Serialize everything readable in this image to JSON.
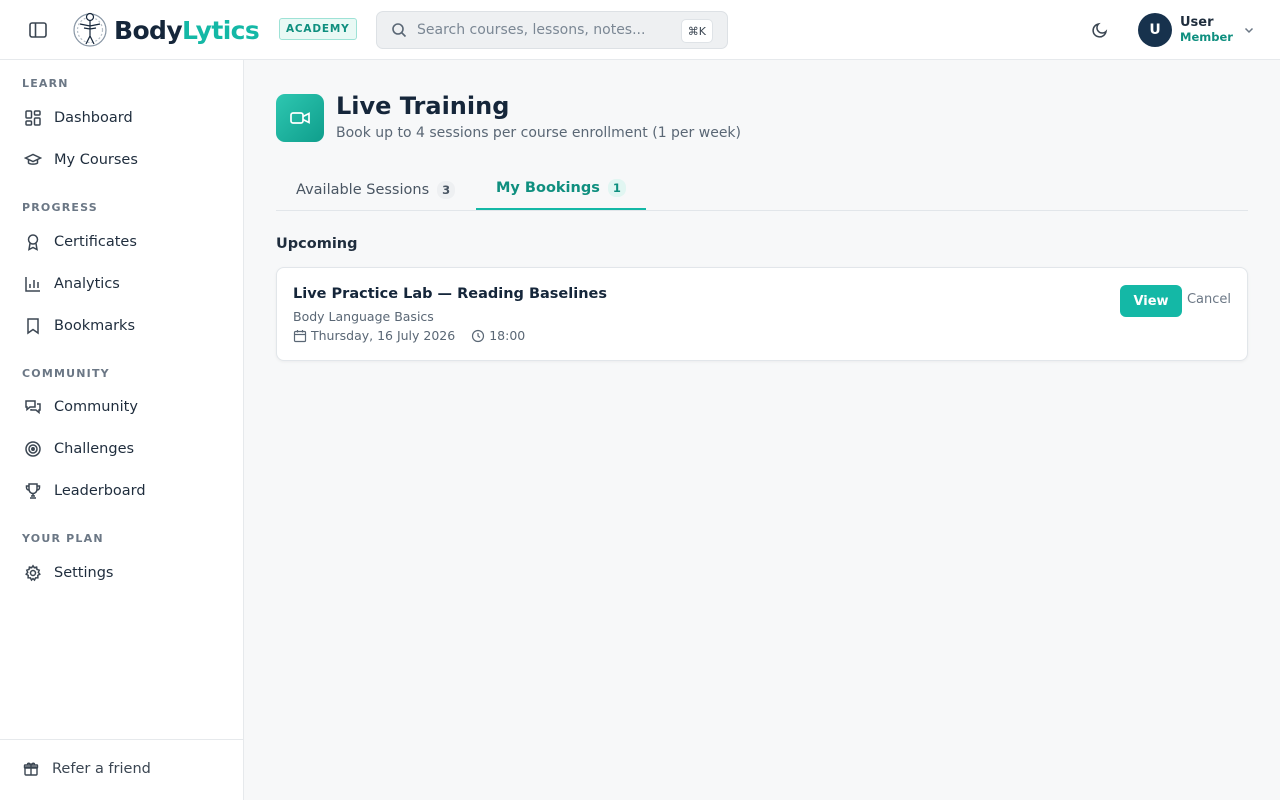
{
  "header": {
    "logo_part1": "Body",
    "logo_part2": "Lytics",
    "badge": "ACADEMY",
    "search_placeholder": "Search courses, lessons, notes...",
    "shortcut": "⌘K",
    "user_name": "User",
    "user_role": "Member",
    "avatar_initial": "U"
  },
  "sidebar": {
    "sections": {
      "learn": "LEARN",
      "progress": "PROGRESS",
      "community": "COMMUNITY",
      "plan": "YOUR PLAN"
    },
    "items": {
      "dashboard": "Dashboard",
      "my_courses": "My Courses",
      "certificates": "Certificates",
      "analytics": "Analytics",
      "bookmarks": "Bookmarks",
      "community": "Community",
      "challenges": "Challenges",
      "leaderboard": "Leaderboard",
      "settings": "Settings"
    },
    "footer": "Refer a friend"
  },
  "main": {
    "title": "Live Training",
    "subtitle": "Book up to 4 sessions per course enrollment (1 per week)",
    "tabs": [
      {
        "label": "Available Sessions",
        "count": "3"
      },
      {
        "label": "My Bookings",
        "count": "1"
      }
    ],
    "section": "Upcoming",
    "booking": {
      "title": "Live Practice Lab — Reading Baselines",
      "course": "Body Language Basics",
      "date": "Thursday, 16 July 2026",
      "time": "18:00",
      "view": "View",
      "cancel": "Cancel"
    }
  },
  "colors": {
    "accent": "#14b8a6",
    "navy": "#15263a"
  }
}
